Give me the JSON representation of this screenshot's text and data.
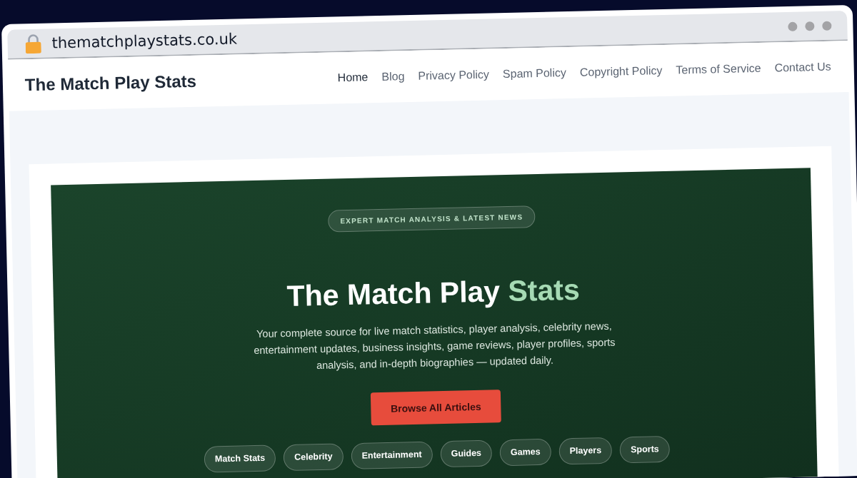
{
  "browser": {
    "url": "thematchplaystats.co.uk"
  },
  "header": {
    "logo": "The Match Play Stats",
    "nav": [
      {
        "label": "Home",
        "selected": true
      },
      {
        "label": "Blog",
        "selected": false
      },
      {
        "label": "Privacy Policy",
        "selected": false
      },
      {
        "label": "Spam Policy",
        "selected": false
      },
      {
        "label": "Copyright Policy",
        "selected": false
      },
      {
        "label": "Terms of Service",
        "selected": false
      },
      {
        "label": "Contact Us",
        "selected": false
      }
    ]
  },
  "hero": {
    "badge": "EXPERT MATCH ANALYSIS & LATEST NEWS",
    "title": {
      "text": "The Match Play",
      "highlight": "Stats"
    },
    "description": "Your complete source for live match statistics, player analysis, celebrity news, entertainment updates, business insights, game reviews, player profiles, sports analysis, and in-depth biographies — updated daily.",
    "button": "Browse All Articles",
    "categories": [
      "Match Stats",
      "Celebrity",
      "Entertainment",
      "Guides",
      "Games",
      "Players",
      "Sports"
    ]
  }
}
